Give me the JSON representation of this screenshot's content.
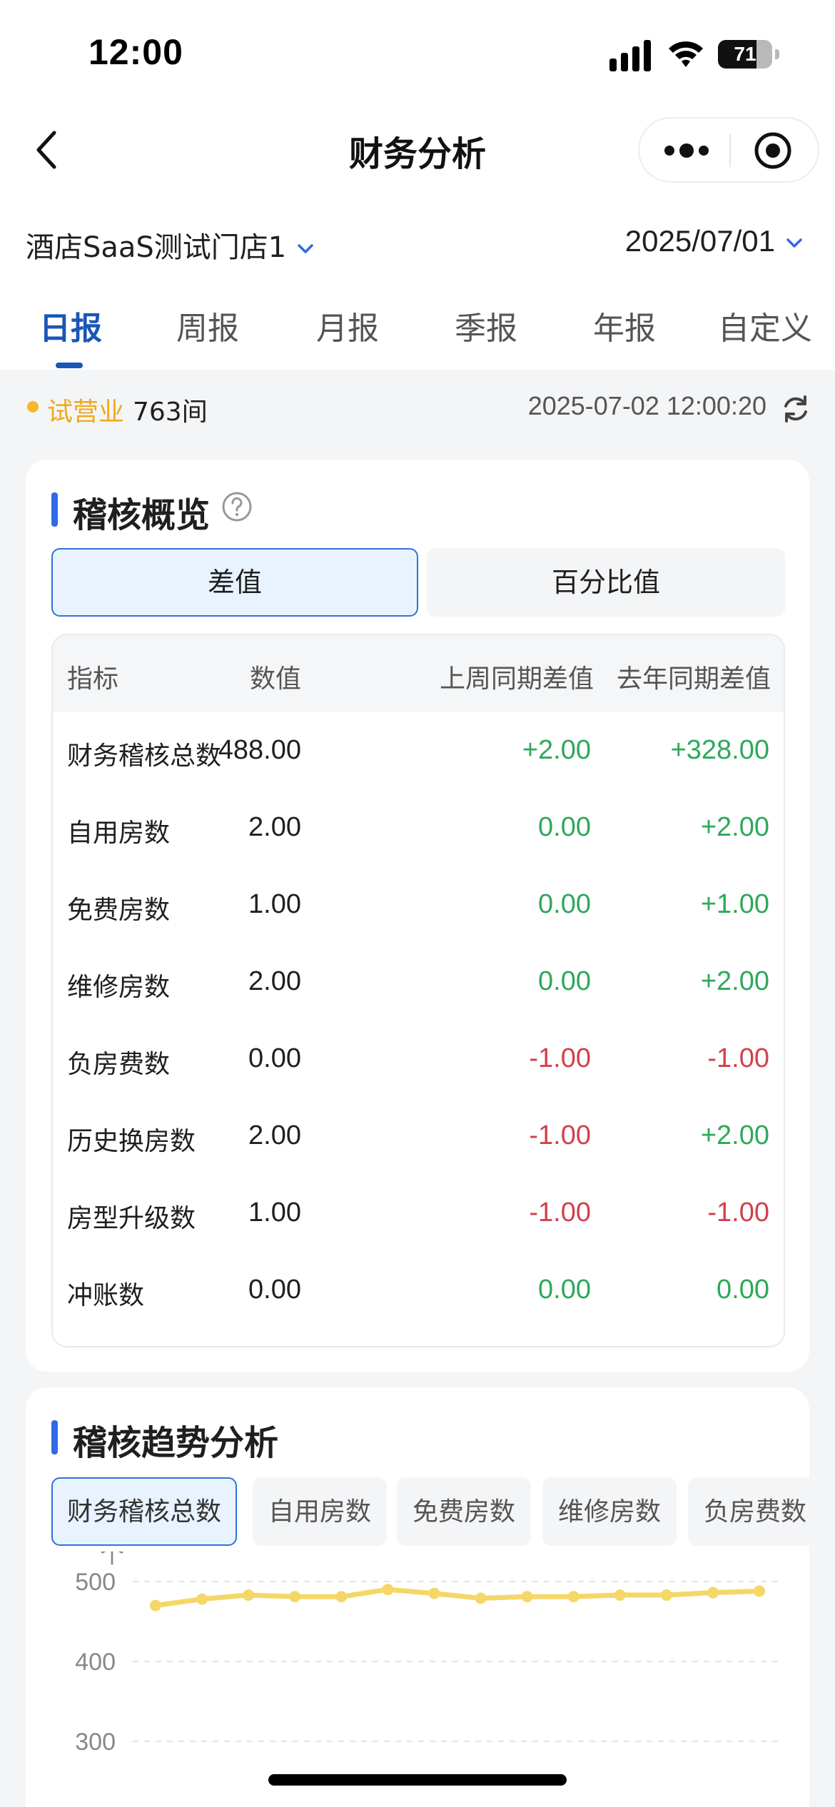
{
  "status_bar": {
    "time": "12:00",
    "battery": "71",
    "battery_level": 0.71
  },
  "nav": {
    "title": "财务分析"
  },
  "filters": {
    "store": "酒店SaaS测试门店1",
    "date": "2025/07/01"
  },
  "tabs": [
    "日报",
    "周报",
    "月报",
    "季报",
    "年报",
    "自定义"
  ],
  "active_tab": 0,
  "info": {
    "status": "试营业",
    "rooms": "763间",
    "updated": "2025-07-02 12:00:20"
  },
  "overview": {
    "title": "稽核概览",
    "segments": [
      "差值",
      "百分比值"
    ],
    "headers": [
      "指标",
      "数值",
      "上周同期差值",
      "去年同期差值"
    ],
    "rows": [
      {
        "name": "财务稽核总数",
        "value": "488.00",
        "week": "+2.00",
        "year": "+328.00"
      },
      {
        "name": "自用房数",
        "value": "2.00",
        "week": "0.00",
        "year": "+2.00"
      },
      {
        "name": "免费房数",
        "value": "1.00",
        "week": "0.00",
        "year": "+1.00"
      },
      {
        "name": "维修房数",
        "value": "2.00",
        "week": "0.00",
        "year": "+2.00"
      },
      {
        "name": "负房费数",
        "value": "0.00",
        "week": "-1.00",
        "year": "-1.00"
      },
      {
        "name": "历史换房数",
        "value": "2.00",
        "week": "-1.00",
        "year": "+2.00"
      },
      {
        "name": "房型升级数",
        "value": "1.00",
        "week": "-1.00",
        "year": "-1.00"
      },
      {
        "name": "冲账数",
        "value": "0.00",
        "week": "0.00",
        "year": "0.00"
      }
    ],
    "colors": {
      "positive": "#2ea85a",
      "negative": "#d2404a",
      "accent": "#2f6ae6"
    }
  },
  "trend": {
    "title": "稽核趋势分析",
    "chips": [
      "财务稽核总数",
      "自用房数",
      "免费房数",
      "维修房数",
      "负房费数"
    ],
    "unit": "个",
    "chart_data": {
      "type": "line",
      "ylabel": "个",
      "y_ticks": [
        500,
        400,
        300
      ],
      "ylim": [
        280,
        520
      ],
      "series": [
        {
          "values": [
            470,
            478,
            483,
            481,
            481,
            490,
            485,
            479,
            481,
            481,
            483,
            483,
            486,
            488
          ]
        }
      ],
      "color": "#f5d767",
      "grid": true
    }
  }
}
